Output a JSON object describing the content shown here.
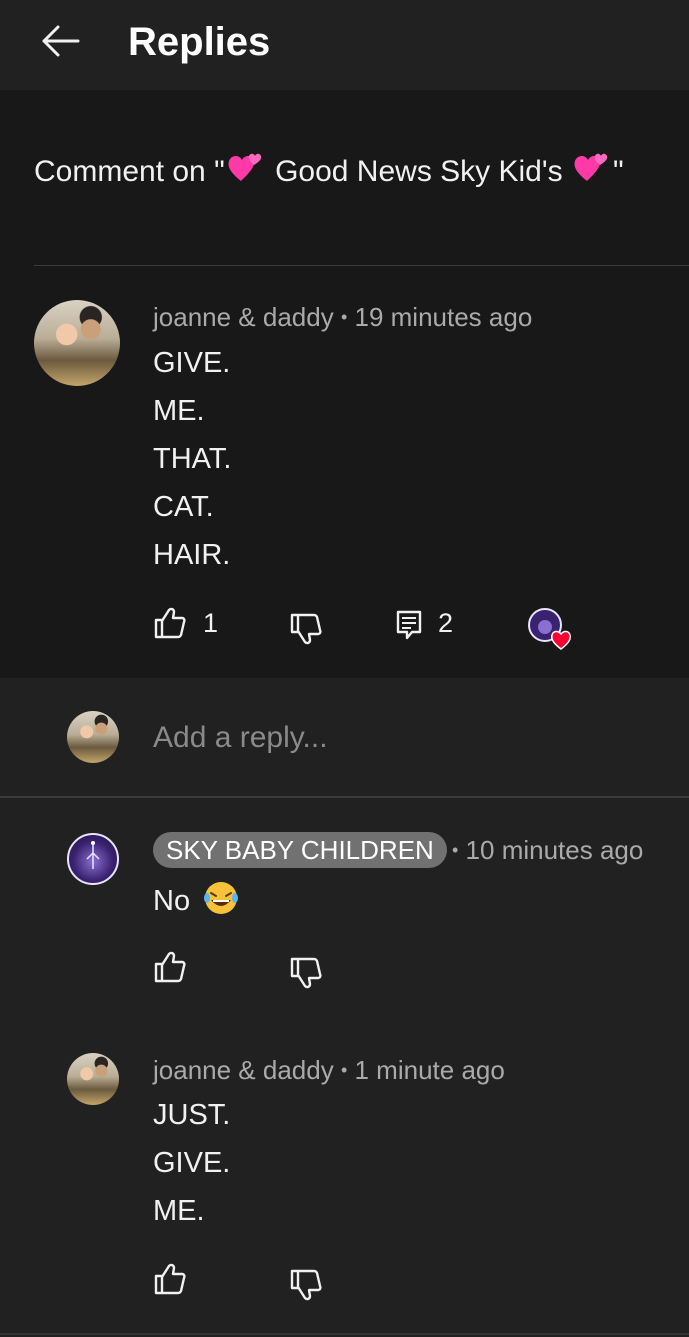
{
  "header": {
    "title": "Replies"
  },
  "context": {
    "prefix": "Comment on \"",
    "video_title": "Good News Sky Kid's",
    "suffix": "\""
  },
  "main_comment": {
    "author": "joanne & daddy",
    "separator": "•",
    "time": "19 minutes ago",
    "lines": [
      "GIVE.",
      "ME.",
      "THAT.",
      "CAT.",
      "HAIR."
    ],
    "like_count": "1",
    "reply_count": "2"
  },
  "reply_box": {
    "placeholder": "Add a reply..."
  },
  "replies": [
    {
      "author": "SKY BABY CHILDREN",
      "separator": "•",
      "time": "10 minutes ago",
      "text": "No",
      "emoji": "😂"
    },
    {
      "author": "joanne & daddy",
      "separator": "•",
      "time": "1 minute ago",
      "lines": [
        "JUST.",
        "GIVE.",
        "ME."
      ]
    }
  ],
  "colors": {
    "background": "#212121",
    "card": "#181818",
    "text": "#f1f1f1",
    "secondary": "#aaaaaa",
    "heart": "#ff0033",
    "badge": "#717171"
  },
  "icons": [
    "back-arrow-icon",
    "heart-emoji-icon",
    "thumbs-up-icon",
    "thumbs-down-icon",
    "comment-icon",
    "creator-heart-icon",
    "laughing-emoji-icon"
  ]
}
